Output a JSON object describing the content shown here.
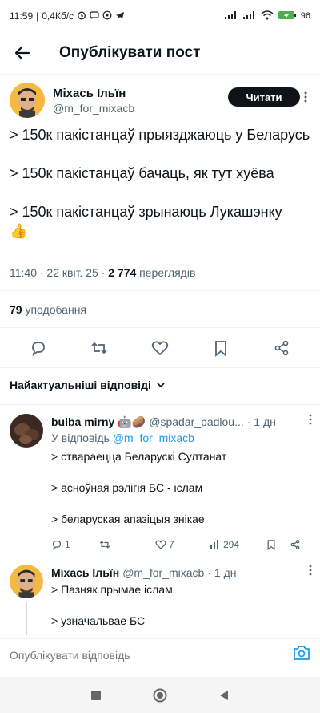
{
  "status_bar": {
    "time": "11:59",
    "speed": "0,4Кб/с",
    "battery": "96"
  },
  "header": {
    "title": "Опублікувати пост"
  },
  "post": {
    "author_name": "Міхась Ільїн",
    "author_handle": "@m_for_mixacb",
    "follow_label": "Читати",
    "lines": [
      "> 150к пакістанцаў прыязджаюць у Беларусь",
      "> 150к пакістанцаў бачаць, як тут хуёва",
      "> 150к пакістанцаў зрынаюць Лукашэнку"
    ],
    "emoji": "👍",
    "time": "11:40 · 22 квіт. 25 ·",
    "views": "2 774",
    "views_label": "переглядів",
    "likes_count": "79",
    "likes_label": "уподобання"
  },
  "replies_sort": {
    "label": "Найактуальніші відповіді"
  },
  "reply1": {
    "name": "bulba mirny",
    "badges": "🤖🥔",
    "handle": "@spadar_padlou...",
    "time": "· 1 дн",
    "replying_prefix": "У відповідь",
    "replying_to": "@m_for_mixacb",
    "lines": [
      "> стварaецца Беларускі Султанат",
      "> асноўная рэлігія БС - іслам",
      "> беларуская апазіцыя знікае"
    ],
    "replies": "1",
    "retweets": "",
    "likes": "7",
    "views": "294"
  },
  "reply2": {
    "name": "Міхась Ільїн",
    "handle": "@m_for_mixacb",
    "time": "· 1 дн",
    "lines": [
      "> Пазняк прымае іслам",
      "> узначальвае БС"
    ]
  },
  "reply_bar": {
    "placeholder": "Опублікувати відповідь"
  },
  "colors": {
    "link": "#1d9bf0",
    "secondary": "#536471",
    "primary": "#0f1419"
  }
}
